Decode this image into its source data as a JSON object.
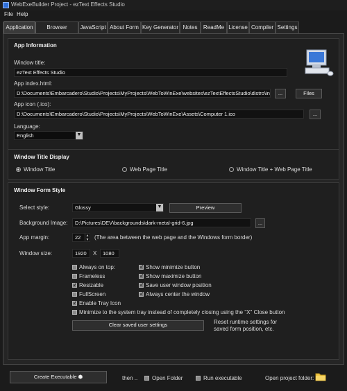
{
  "window": {
    "title": "WebExeBuilder Project - ezText Effects Studio"
  },
  "menu": {
    "file": "File",
    "help": "Help"
  },
  "tabs": [
    {
      "label": "Application",
      "active": true
    },
    {
      "label": "Browser Settings"
    },
    {
      "label": "JavaScript"
    },
    {
      "label": "About Form"
    },
    {
      "label": "Key Generator"
    },
    {
      "label": "Notes"
    },
    {
      "label": "ReadMe"
    },
    {
      "label": "License"
    },
    {
      "label": "Compiler"
    },
    {
      "label": "Settings"
    }
  ],
  "app_info": {
    "title": "App Information",
    "window_title_label": "Window title:",
    "window_title_value": "ezText Effects Studio",
    "index_label": "App index.html:",
    "index_value": "D:\\Documents\\Embarcadero\\Studio\\Projects\\MyProjects\\WebToWinExe\\websites\\ezTextEffectsStudio\\distro\\inde",
    "browse_label": "...",
    "files_label": "Files",
    "icon_label": "App icon (.ico):",
    "icon_value": "D:\\Documents\\Embarcadero\\Studio\\Projects\\MyProjects\\WebToWinExe\\Assets\\Computer 1.ico",
    "icon_browse_label": "...",
    "language_label": "Language:",
    "language_value": "English"
  },
  "title_display": {
    "title": "Window Title Display",
    "options": [
      "Window Title",
      "Web Page Title",
      "Window Title + Web Page Title"
    ],
    "selected_index": 0
  },
  "form_style": {
    "title": "Window Form Style",
    "select_style_label": "Select style:",
    "select_style_value": "Glossy",
    "preview_label": "Preview",
    "bg_image_label": "Background Image:",
    "bg_image_value": "D:\\Pictures\\DEV\\backgrounds\\dark-metal-grid-6.jpg",
    "bg_browse_label": "...",
    "margin_label": "App margin:",
    "margin_value": "22",
    "margin_note": "(The area between the web page and the Windows form border)",
    "size_label": "Window size:",
    "width_value": "1920",
    "size_x": "X",
    "height_value": "1080",
    "checks_left": [
      {
        "label": "Always on top:",
        "checked": false
      },
      {
        "label": "Frameless",
        "checked": false
      },
      {
        "label": "Resizable",
        "checked": true
      },
      {
        "label": "FullScreen",
        "checked": false
      },
      {
        "label": "Enable Tray Icon",
        "checked": true
      }
    ],
    "checks_right": [
      {
        "label": "Show minimize button",
        "checked": true
      },
      {
        "label": "Show maximize button",
        "checked": true
      },
      {
        "label": "Save user window position",
        "checked": true
      },
      {
        "label": "Always center the window",
        "checked": true
      }
    ],
    "tray_close": {
      "label": "Minimize to the system tray instead of completely closing using the \"X\" Close button",
      "checked": false
    },
    "clear_label": "Clear saved user settings",
    "reset_note": "Reset runtime settings for saved form position, etc."
  },
  "footer": {
    "create_label": "Create Executable",
    "then_label": "then ..",
    "open_folder": {
      "label": "Open Folder",
      "checked": false
    },
    "run_exe": {
      "label": "Run executable",
      "checked": false
    },
    "open_project_label": "Open project folder:"
  }
}
